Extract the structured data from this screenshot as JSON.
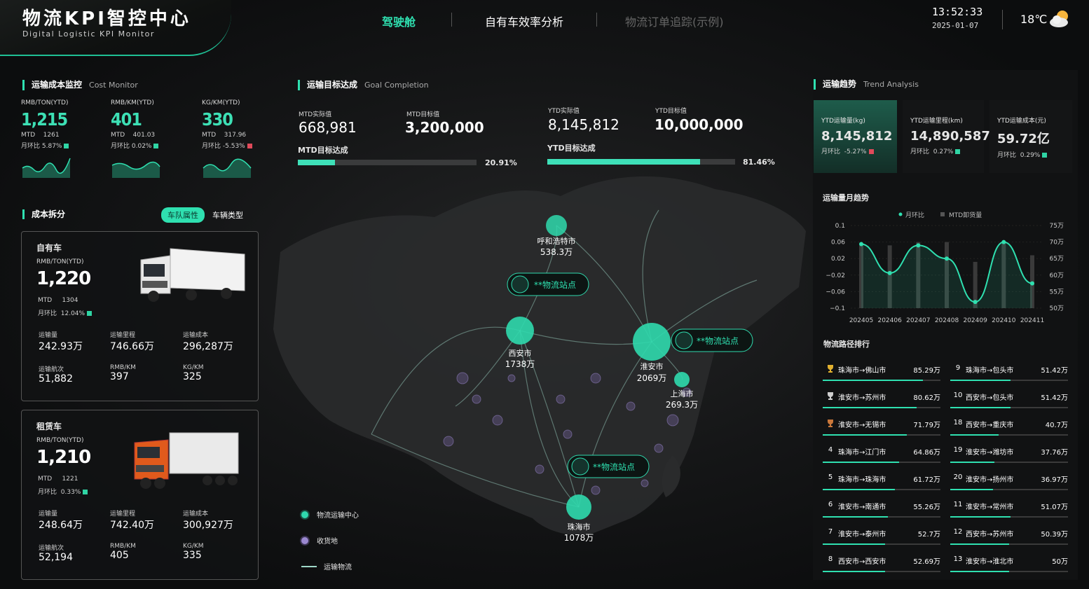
{
  "header": {
    "title": "物流KPI智控中心",
    "subtitle": "Digital Logistic KPI Monitor",
    "time": "13:52:33",
    "date": "2025-01-07",
    "temperature": "18℃",
    "nav": [
      {
        "label": "驾驶舱",
        "active": true
      },
      {
        "label": "自有车效率分析",
        "active": false
      },
      {
        "label": "物流订单追踪(示例)",
        "active": false
      }
    ]
  },
  "cost_monitor": {
    "title": "运输成本监控",
    "title_en": "Cost Monitor",
    "items": [
      {
        "label": "RMB/TON(YTD)",
        "value": "1,215",
        "mtd_label": "MTD",
        "mtd": "1261",
        "mom_label": "月环比",
        "mom": "5.87%",
        "trend": "up"
      },
      {
        "label": "RMB/KM(YTD)",
        "value": "401",
        "mtd_label": "MTD",
        "mtd": "401.03",
        "mom_label": "月环比",
        "mom": "0.02%",
        "trend": "up"
      },
      {
        "label": "KG/KM(YTD)",
        "value": "330",
        "mtd_label": "MTD",
        "mtd": "317.96",
        "mom_label": "月环比",
        "mom": "-5.53%",
        "trend": "down"
      }
    ]
  },
  "cost_split": {
    "title": "成本拆分",
    "tabs": [
      "车队属性",
      "车辆类型"
    ],
    "cards": [
      {
        "name": "自有车",
        "label": "RMB/TON(YTD)",
        "value": "1,220",
        "mtd_label": "MTD",
        "mtd": "1304",
        "mom_label": "月环比",
        "mom": "12.04%",
        "stats": [
          {
            "k": "运输量",
            "v": "242.93万"
          },
          {
            "k": "运输里程",
            "v": "746.66万"
          },
          {
            "k": "运输成本",
            "v": "296,287万"
          },
          {
            "k": "运输航次",
            "v": "51,882"
          },
          {
            "k": "RMB/KM",
            "v": "397"
          },
          {
            "k": "KG/KM",
            "v": "325"
          }
        ]
      },
      {
        "name": "租赁车",
        "label": "RMB/TON(YTD)",
        "value": "1,210",
        "mtd_label": "MTD",
        "mtd": "1221",
        "mom_label": "月环比",
        "mom": "0.33%",
        "stats": [
          {
            "k": "运输量",
            "v": "248.64万"
          },
          {
            "k": "运输里程",
            "v": "742.40万"
          },
          {
            "k": "运输成本",
            "v": "300,927万"
          },
          {
            "k": "运输航次",
            "v": "52,194"
          },
          {
            "k": "RMB/KM",
            "v": "405"
          },
          {
            "k": "KG/KM",
            "v": "335"
          }
        ]
      }
    ]
  },
  "goal": {
    "title": "运输目标达成",
    "title_en": "Goal Completion",
    "mtd_actual_label": "MTD实际值",
    "mtd_actual": "668,981",
    "mtd_target_label": "MTD目标值",
    "mtd_target": "3,200,000",
    "ytd_actual_label": "YTD实际值",
    "ytd_actual": "8,145,812",
    "ytd_target_label": "YTD目标值",
    "ytd_target": "10,000,000",
    "mtd_bar_label": "MTD目标达成",
    "mtd_pct": "20.91%",
    "mtd_fill": 0.2091,
    "ytd_bar_label": "YTD目标达成",
    "ytd_pct": "81.46%",
    "ytd_fill": 0.8146
  },
  "map": {
    "cities": [
      {
        "name": "呼和浩特市",
        "val": "538.3万"
      },
      {
        "name": "西安市",
        "val": "1738万"
      },
      {
        "name": "淮安市",
        "val": "2069万"
      },
      {
        "name": "上海市",
        "val": "269.3万"
      },
      {
        "name": "珠海市",
        "val": "1078万"
      }
    ],
    "stations": [
      "**物流站点",
      "**物流站点",
      "**物流站点"
    ],
    "legend": [
      "物流运输中心",
      "收货地",
      "运输物流"
    ]
  },
  "trend": {
    "title": "运输趋势",
    "title_en": "Trend Analysis",
    "kpis": [
      {
        "label": "YTD运输量(kg)",
        "value": "8,145,812",
        "mom_label": "月环比",
        "mom": "-5.27%",
        "trend": "down"
      },
      {
        "label": "YTD运输里程(km)",
        "value": "14,890,587",
        "mom_label": "月环比",
        "mom": "0.27%",
        "trend": "up"
      },
      {
        "label": "YTD运输成本(元)",
        "value": "59.72亿",
        "mom_label": "月环比",
        "mom": "0.29%",
        "trend": "up"
      }
    ],
    "monthly_title": "运输量月趋势"
  },
  "chart_data": {
    "type": "line",
    "legend": [
      "月环比",
      "MTD卸货量"
    ],
    "categories": [
      "202405",
      "202406",
      "202407",
      "202408",
      "202409",
      "202410",
      "202411"
    ],
    "series": [
      {
        "name": "月环比",
        "values": [
          0.055,
          -0.015,
          0.052,
          0.02,
          -0.085,
          0.06,
          -0.04
        ]
      },
      {
        "name": "MTD卸货量",
        "values": [
          69,
          69,
          70,
          70,
          64,
          70,
          66
        ]
      }
    ],
    "y_left_ticks": [
      "0.1",
      "0.06",
      "0.02",
      "−0.02",
      "−0.06",
      "−0.1"
    ],
    "y_left_lim": [
      -0.1,
      0.1
    ],
    "y_right_ticks": [
      "75万",
      "70万",
      "65万",
      "60万",
      "55万",
      "50万"
    ],
    "y_right_lim": [
      50,
      75
    ]
  },
  "routes": {
    "title": "物流路径排行",
    "left": [
      {
        "rank": "1",
        "name": "珠海市→佛山市",
        "val": "85.29万",
        "pct": 1.0,
        "medal": "gold"
      },
      {
        "rank": "2",
        "name": "淮安市→苏州市",
        "val": "80.62万",
        "pct": 0.94,
        "medal": "silver"
      },
      {
        "rank": "3",
        "name": "淮安市→无锡市",
        "val": "71.79万",
        "pct": 0.84,
        "medal": "bronze"
      },
      {
        "rank": "4",
        "name": "珠海市→江门市",
        "val": "64.86万",
        "pct": 0.76
      },
      {
        "rank": "5",
        "name": "珠海市→珠海市",
        "val": "61.72万",
        "pct": 0.72
      },
      {
        "rank": "6",
        "name": "淮安市→南通市",
        "val": "55.26万",
        "pct": 0.65
      },
      {
        "rank": "7",
        "name": "淮安市→泰州市",
        "val": "52.7万",
        "pct": 0.62
      },
      {
        "rank": "8",
        "name": "西安市→西安市",
        "val": "52.69万",
        "pct": 0.62
      }
    ],
    "right": [
      {
        "rank": "9",
        "name": "珠海市→包头市",
        "val": "51.42万",
        "pct": 0.6
      },
      {
        "rank": "10",
        "name": "西安市→包头市",
        "val": "51.42万",
        "pct": 0.6
      },
      {
        "rank": "18",
        "name": "西安市→重庆市",
        "val": "40.7万",
        "pct": 0.48
      },
      {
        "rank": "19",
        "name": "淮安市→潍坊市",
        "val": "37.76万",
        "pct": 0.44
      },
      {
        "rank": "20",
        "name": "淮安市→扬州市",
        "val": "36.97万",
        "pct": 0.43
      },
      {
        "rank": "11",
        "name": "淮安市→常州市",
        "val": "51.07万",
        "pct": 0.6
      },
      {
        "rank": "12",
        "name": "西安市→苏州市",
        "val": "50.39万",
        "pct": 0.59
      },
      {
        "rank": "13",
        "name": "淮安市→淮北市",
        "val": "50万",
        "pct": 0.59
      }
    ]
  },
  "colors": {
    "accent": "#2fe0b0",
    "up": "#2fd4a4",
    "down": "#e04a5a"
  }
}
